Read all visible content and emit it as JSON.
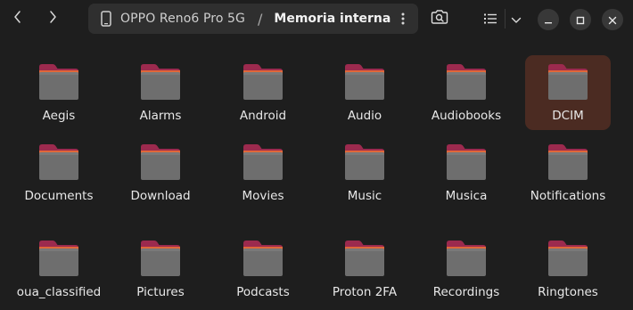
{
  "nav": {
    "back_icon": "chevron-left-icon",
    "forward_icon": "chevron-right-icon"
  },
  "pathbar": {
    "device_icon": "phone-icon",
    "device": "OPPO Reno6 Pro 5G",
    "separator": "/",
    "current": "Memoria interna",
    "menu_icon": "kebab-icon"
  },
  "toolbar": {
    "search_icon": "search-camera-icon",
    "view_icon": "list-view-icon",
    "view_dropdown_icon": "chevron-down-icon"
  },
  "window_controls": [
    "minimize-icon",
    "maximize-icon",
    "close-icon"
  ],
  "colors": {
    "background": "#1e1e1e",
    "selection": "#4b2b22",
    "folder_body": "#6e6e6e",
    "folder_tab": "#e0673a",
    "folder_tab_dark": "#9c2a4e"
  },
  "items": [
    {
      "label": "Aegis"
    },
    {
      "label": "Alarms"
    },
    {
      "label": "Android"
    },
    {
      "label": "Audio"
    },
    {
      "label": "Audiobooks"
    },
    {
      "label": "DCIM",
      "selected": true
    },
    {
      "label": "Documents"
    },
    {
      "label": "Download"
    },
    {
      "label": "Movies"
    },
    {
      "label": "Music"
    },
    {
      "label": "Musica"
    },
    {
      "label": "Notifications"
    },
    {
      "label": "oua_classified"
    },
    {
      "label": "Pictures"
    },
    {
      "label": "Podcasts"
    },
    {
      "label": "Proton 2FA"
    },
    {
      "label": "Recordings"
    },
    {
      "label": "Ringtones"
    }
  ]
}
